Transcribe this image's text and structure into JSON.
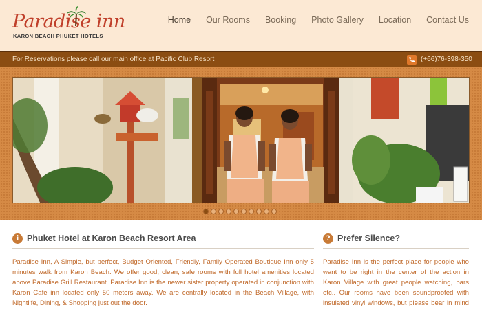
{
  "brand": {
    "logo_text": "Paradise inn",
    "logo_subtitle": "KARON BEACH PHUKET HOTELS"
  },
  "nav": {
    "items": [
      {
        "label": "Home",
        "active": true
      },
      {
        "label": "Our Rooms",
        "active": false
      },
      {
        "label": "Booking",
        "active": false
      },
      {
        "label": "Photo Gallery",
        "active": false
      },
      {
        "label": "Location",
        "active": false
      },
      {
        "label": "Contact Us",
        "active": false
      }
    ]
  },
  "reservation": {
    "text": "For Reservations please call our main office at Pacific Club Resort",
    "phone": "(+66)76-398-350",
    "phone_icon": "phone-icon"
  },
  "slider": {
    "dot_count": 10,
    "active_index": 0
  },
  "sections": {
    "left": {
      "icon": "info-icon",
      "icon_glyph": "i",
      "title": "Phuket Hotel at Karon Beach Resort Area",
      "body": "Paradise Inn, A Simple, but perfect, Budget Oriented, Friendly, Family Operated Boutique Inn only 5 minutes walk from Karon Beach. We offer good, clean, safe rooms with full hotel amenities located above Paradise Grill Restaurant. Paradise Inn is the newer sister property operated in conjunction with Karon Cafe inn located only 50 meters away. We are centrally located in the Beach Village, with Nightlife, Dining, & Shopping just out the door."
    },
    "right": {
      "icon": "question-icon",
      "icon_glyph": "?",
      "title": "Prefer Silence?",
      "body": "Paradise Inn is the perfect place for people who want to be right in the center of the action in Karon Village with great people watching, bars etc.. Our rooms have been soundproofed with insulated vinyl windows, but please bear in mind this is not a quiet area. If you are looking for"
    }
  },
  "colors": {
    "header_bg": "#fce9d4",
    "accent": "#c87a36",
    "bar_bg": "#8b4d12",
    "body_text": "#c0692a"
  }
}
